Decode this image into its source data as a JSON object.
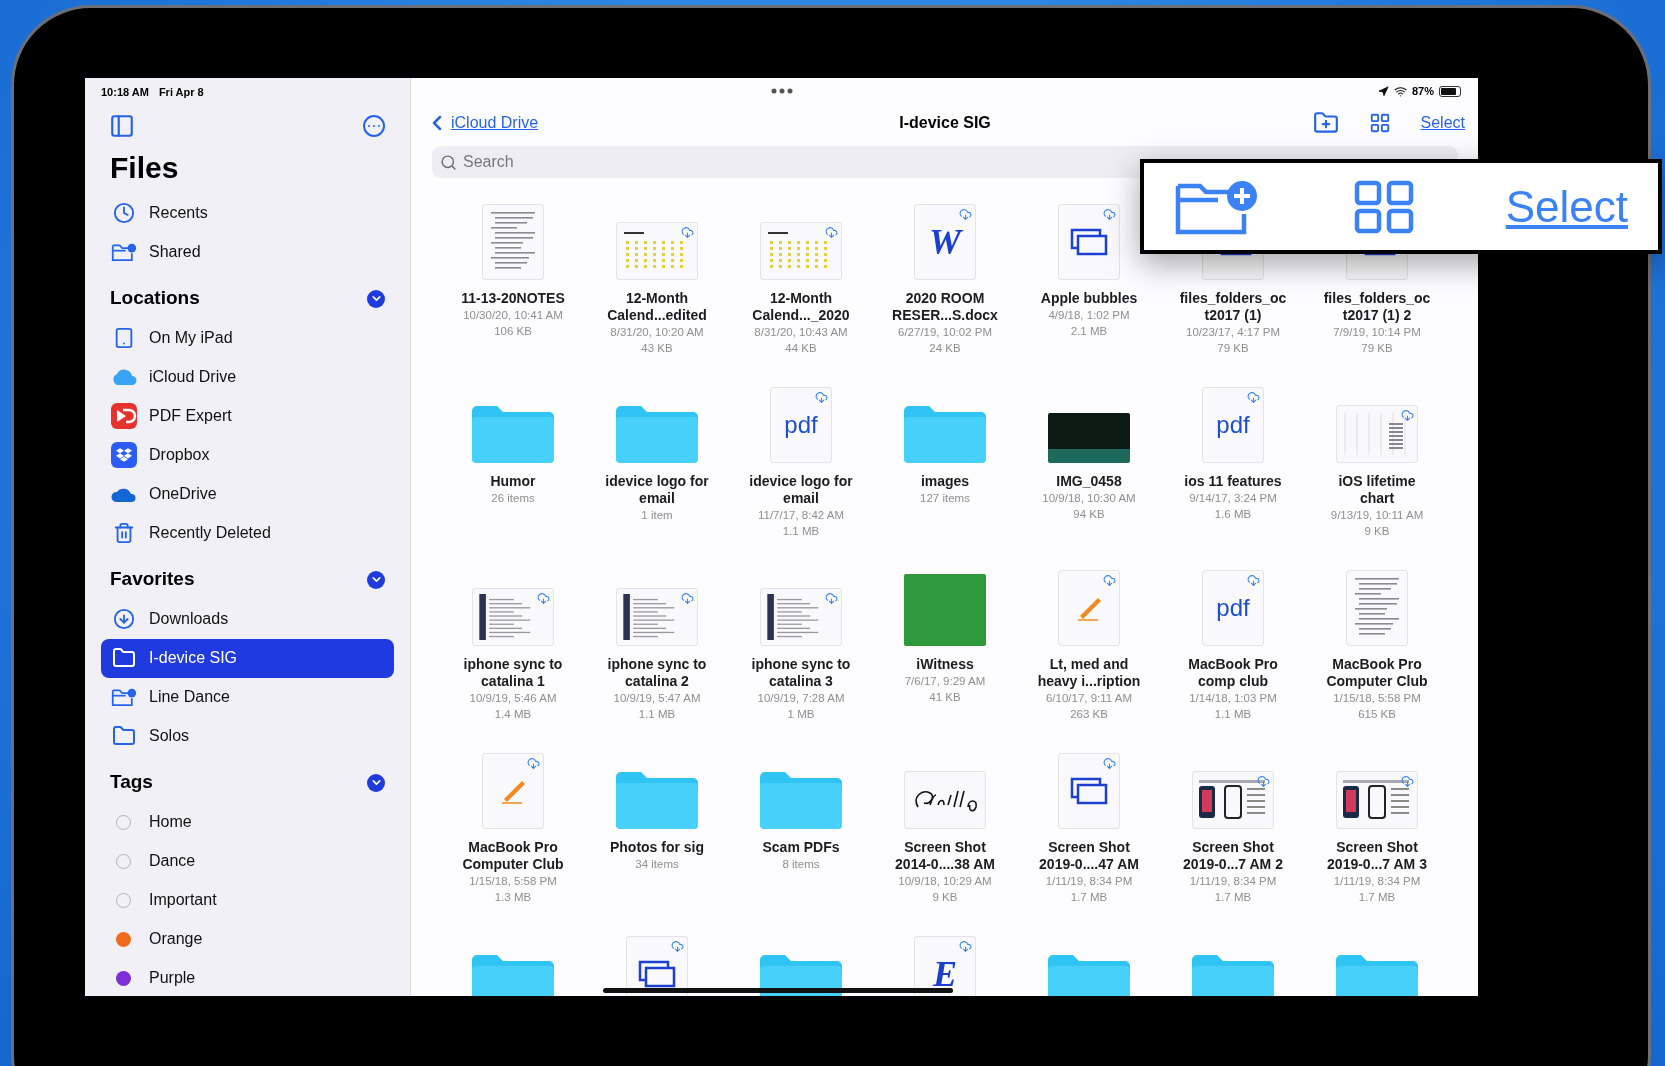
{
  "status_bar": {
    "time": "10:18 AM",
    "date": "Fri Apr 8",
    "battery": "87%"
  },
  "sidebar": {
    "title": "Files",
    "top_items": [
      {
        "label": "Recents",
        "kind": "clock",
        "selected": false
      },
      {
        "label": "Shared",
        "kind": "shared",
        "selected": false
      }
    ],
    "sections": [
      {
        "title": "Locations",
        "expanded": true,
        "items": [
          {
            "label": "On My iPad",
            "kind": "ipad",
            "selected": false
          },
          {
            "label": "iCloud Drive",
            "kind": "icloud",
            "selected": false
          },
          {
            "label": "PDF Expert",
            "kind": "pdfexpert",
            "selected": false
          },
          {
            "label": "Dropbox",
            "kind": "dropbox",
            "selected": false
          },
          {
            "label": "OneDrive",
            "kind": "onedrive",
            "selected": false
          },
          {
            "label": "Recently Deleted",
            "kind": "trash",
            "selected": false
          }
        ]
      },
      {
        "title": "Favorites",
        "expanded": true,
        "items": [
          {
            "label": "Downloads",
            "kind": "download",
            "selected": false
          },
          {
            "label": "I-device SIG",
            "kind": "folder",
            "selected": true
          },
          {
            "label": "Line Dance",
            "kind": "shared",
            "selected": false
          },
          {
            "label": "Solos",
            "kind": "folder",
            "selected": false
          }
        ]
      },
      {
        "title": "Tags",
        "expanded": true,
        "items": [
          {
            "label": "Home",
            "kind": "tag",
            "selected": false
          },
          {
            "label": "Dance",
            "kind": "tag",
            "selected": false
          },
          {
            "label": "Important",
            "kind": "tag",
            "selected": false
          },
          {
            "label": "Orange",
            "kind": "tag",
            "color": "#f26b1d",
            "selected": false
          },
          {
            "label": "Purple",
            "kind": "tag",
            "color": "#7b2fd4",
            "selected": false
          }
        ]
      }
    ]
  },
  "header": {
    "back": "iCloud Drive",
    "title": "I-device SIG",
    "select": "Select"
  },
  "search": {
    "placeholder": "Search"
  },
  "callout": {
    "select": "Select"
  },
  "files": [
    {
      "name": [
        "11-13-20NOTES"
      ],
      "kind": "doc",
      "cloud": false,
      "details": [
        "10/30/20, 10:41 AM",
        "106 KB"
      ]
    },
    {
      "name": [
        "12-Month",
        "Calend...edited"
      ],
      "kind": "calendar",
      "cloud": true,
      "details": [
        "8/31/20, 10:20 AM",
        "43 KB"
      ]
    },
    {
      "name": [
        "12-Month",
        "Calend..._2020"
      ],
      "kind": "calendar",
      "cloud": true,
      "details": [
        "8/31/20, 10:43 AM",
        "44 KB"
      ]
    },
    {
      "name": [
        "2020 ROOM",
        "RESER...S.docx"
      ],
      "kind": "letter",
      "glyph": "W",
      "cloud": true,
      "details": [
        "6/27/19, 10:02 PM",
        "24 KB"
      ]
    },
    {
      "name": [
        "Apple bubbles"
      ],
      "kind": "keynote",
      "cloud": true,
      "details": [
        "4/9/18, 1:02 PM",
        "2.1 MB"
      ]
    },
    {
      "name": [
        "files_folders_oc",
        "t2017 (1)"
      ],
      "kind": "keynote",
      "cloud": false,
      "details": [
        "10/23/17, 4:17 PM",
        "79 KB"
      ]
    },
    {
      "name": [
        "files_folders_oc",
        "t2017 (1) 2"
      ],
      "kind": "keynote",
      "cloud": false,
      "details": [
        "7/9/19, 10:14 PM",
        "79 KB"
      ]
    },
    {
      "name": [
        "Humor"
      ],
      "kind": "folder",
      "details": [
        "26 items"
      ]
    },
    {
      "name": [
        "idevice logo for",
        "email"
      ],
      "kind": "folder",
      "details": [
        "1 item"
      ]
    },
    {
      "name": [
        "idevice logo for",
        "email"
      ],
      "kind": "letter",
      "glyph": "pdf",
      "cloud": true,
      "details": [
        "11/7/17, 8:42 AM",
        "1.1 MB"
      ]
    },
    {
      "name": [
        "images"
      ],
      "kind": "folder",
      "details": [
        "127 items"
      ]
    },
    {
      "name": [
        "IMG_0458"
      ],
      "kind": "photo",
      "details": [
        "10/9/18, 10:30 AM",
        "94 KB"
      ]
    },
    {
      "name": [
        "ios 11 features"
      ],
      "kind": "letter",
      "glyph": "pdf",
      "cloud": true,
      "details": [
        "9/14/17, 3:24 PM",
        "1.6 MB"
      ]
    },
    {
      "name": [
        "iOS lifetime",
        "chart"
      ],
      "kind": "chart",
      "cloud": true,
      "details": [
        "9/13/19, 10:11 AM",
        "9 KB"
      ]
    },
    {
      "name": [
        "iphone sync to",
        "catalina 1"
      ],
      "kind": "screenshot",
      "cloud": true,
      "details": [
        "10/9/19, 5:46 AM",
        "1.4 MB"
      ]
    },
    {
      "name": [
        "iphone sync to",
        "catalina 2"
      ],
      "kind": "screenshot",
      "cloud": true,
      "details": [
        "10/9/19, 5:47 AM",
        "1.1 MB"
      ]
    },
    {
      "name": [
        "iphone sync to",
        "catalina 3"
      ],
      "kind": "screenshot",
      "cloud": true,
      "details": [
        "10/9/19, 7:28 AM",
        "1 MB"
      ]
    },
    {
      "name": [
        "iWitness"
      ],
      "kind": "meme",
      "details": [
        "7/6/17, 9:29 AM",
        "41 KB"
      ]
    },
    {
      "name": [
        "Lt, med and",
        "heavy i...ription"
      ],
      "kind": "pages",
      "cloud": true,
      "details": [
        "6/10/17, 9:11 AM",
        "263 KB"
      ]
    },
    {
      "name": [
        "MacBook Pro",
        "comp club"
      ],
      "kind": "letter",
      "glyph": "pdf",
      "cloud": true,
      "details": [
        "1/14/18, 1:03 PM",
        "1.1 MB"
      ]
    },
    {
      "name": [
        "MacBook Pro",
        "Computer Club"
      ],
      "kind": "doc",
      "cloud": false,
      "details": [
        "1/15/18, 5:58 PM",
        "615 KB"
      ]
    },
    {
      "name": [
        "MacBook Pro",
        "Computer Club"
      ],
      "kind": "pages",
      "cloud": true,
      "details": [
        "1/15/18, 5:58 PM",
        "1.3 MB"
      ]
    },
    {
      "name": [
        "Photos for sig"
      ],
      "kind": "folder",
      "details": [
        "34 items"
      ]
    },
    {
      "name": [
        "Scam PDFs"
      ],
      "kind": "folder",
      "details": [
        "8 items"
      ]
    },
    {
      "name": [
        "Screen Shot",
        "2014-0....38 AM"
      ],
      "kind": "signature",
      "cloud": false,
      "details": [
        "10/9/18, 10:29 AM",
        "9 KB"
      ]
    },
    {
      "name": [
        "Screen Shot",
        "2019-0....47 AM"
      ],
      "kind": "keynote",
      "cloud": true,
      "details": [
        "1/11/19, 8:34 PM",
        "1.7 MB"
      ]
    },
    {
      "name": [
        "Screen Shot",
        "2019-0...7 AM 2"
      ],
      "kind": "phones",
      "cloud": true,
      "details": [
        "1/11/19, 8:34 PM",
        "1.7 MB"
      ]
    },
    {
      "name": [
        "Screen Shot",
        "2019-0...7 AM 3"
      ],
      "kind": "phones",
      "cloud": true,
      "details": [
        "1/11/19, 8:34 PM",
        "1.7 MB"
      ]
    },
    {
      "kind": "folder"
    },
    {
      "kind": "keynote",
      "cloud": true
    },
    {
      "kind": "folder"
    },
    {
      "kind": "letter",
      "glyph": "E",
      "cloud": true
    },
    {
      "kind": "folder"
    },
    {
      "kind": "folder"
    },
    {
      "kind": "folder"
    }
  ]
}
